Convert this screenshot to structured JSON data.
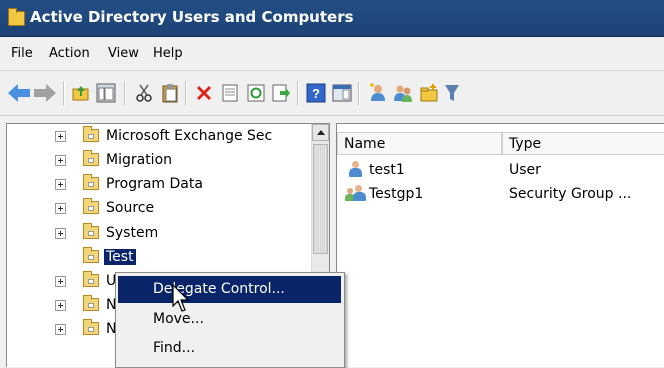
{
  "window": {
    "title": "Active Directory Users and Computers"
  },
  "menu": [
    "File",
    "Action",
    "View",
    "Help"
  ],
  "toolbar": {
    "icons": [
      "back-arrow-icon",
      "forward-arrow-icon",
      "up-folder-icon",
      "show-console-tree-icon",
      "cut-icon",
      "paste-icon",
      "delete-icon",
      "properties-icon",
      "refresh-icon",
      "export-list-icon",
      "help-icon",
      "show-hide-icon",
      "new-user-icon",
      "new-group-icon",
      "new-ou-icon",
      "filter-icon"
    ]
  },
  "tree": {
    "items": [
      {
        "label": "Microsoft Exchange Sec",
        "expandable": true,
        "icon": "ou-folder-icon"
      },
      {
        "label": "Migration",
        "expandable": true,
        "icon": "ou-folder-icon"
      },
      {
        "label": "Program Data",
        "expandable": true,
        "icon": "folder-icon"
      },
      {
        "label": "Source",
        "expandable": true,
        "icon": "folder-icon"
      },
      {
        "label": "System",
        "expandable": true,
        "icon": "folder-icon"
      },
      {
        "label": "Test",
        "expandable": false,
        "icon": "ou-folder-icon",
        "selected": true
      },
      {
        "label": "U",
        "expandable": true,
        "icon": "folder-icon"
      },
      {
        "label": "N",
        "expandable": true,
        "icon": "folder-icon"
      },
      {
        "label": "N",
        "expandable": true,
        "icon": "folder-icon"
      }
    ]
  },
  "list": {
    "columns": [
      "Name",
      "Type"
    ],
    "rows": [
      {
        "name": "test1",
        "type": "User",
        "icon": "user-icon"
      },
      {
        "name": "Testgp1",
        "type": "Security Group ...",
        "icon": "group-icon"
      }
    ]
  },
  "context_menu": {
    "items": [
      {
        "label": "Delegate Control...",
        "highlighted": true
      },
      {
        "label": "Move...",
        "highlighted": false
      },
      {
        "label": "Find...",
        "highlighted": false
      }
    ]
  },
  "colors": {
    "title_bar": "#1f4679",
    "selection": "#0a246a",
    "accent": "#3b8be0"
  }
}
